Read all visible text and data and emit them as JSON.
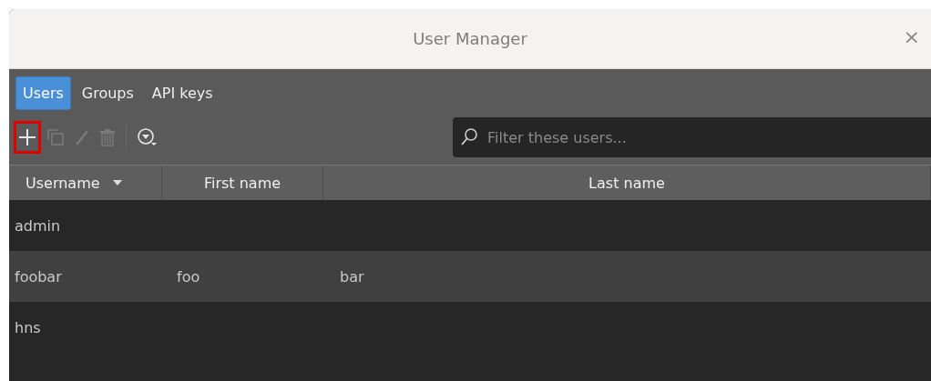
{
  "window": {
    "title": "User Manager",
    "close": "×"
  },
  "tabs": [
    {
      "label": "Users",
      "selected": true
    },
    {
      "label": "Groups",
      "selected": false
    },
    {
      "label": "API keys",
      "selected": false
    }
  ],
  "toolbar": [
    {
      "kind": "add",
      "disabled": false,
      "highlighted": true
    },
    {
      "kind": "copy",
      "disabled": true,
      "highlighted": false
    },
    {
      "kind": "edit",
      "disabled": true,
      "highlighted": false
    },
    {
      "kind": "delete",
      "disabled": true,
      "highlighted": false
    },
    {
      "kind": "separator"
    },
    {
      "kind": "filter",
      "disabled": false,
      "highlighted": false
    }
  ],
  "search": {
    "placeholder": "Filter these users..."
  },
  "table": {
    "columns": [
      {
        "label": "Username",
        "sorted": true
      },
      {
        "label": "First name",
        "sorted": false
      },
      {
        "label": "Last name",
        "sorted": false
      }
    ],
    "rows": [
      [
        "admin",
        "",
        ""
      ],
      [
        "foobar",
        "foo",
        "bar"
      ],
      [
        "hns",
        "",
        ""
      ]
    ]
  }
}
